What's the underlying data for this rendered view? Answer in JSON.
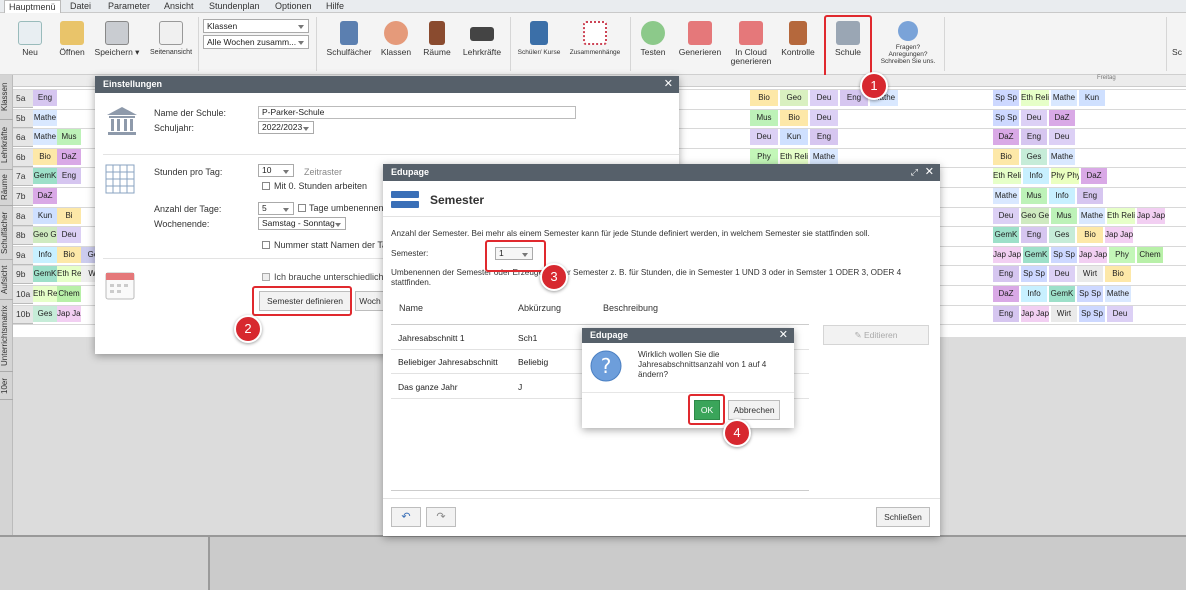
{
  "menu": {
    "items": [
      "Hauptmenü",
      "Datei",
      "Parameter",
      "Ansicht",
      "Stundenplan",
      "Optionen",
      "Hilfe"
    ]
  },
  "ribbon": {
    "new": "Neu",
    "open": "Öffnen",
    "save": "Speichern",
    "preview": "Seitenansicht",
    "combo1": "Klassen",
    "combo2": "Alle Wochen zusamm...",
    "subjects": "Schulfächer",
    "classes": "Klassen",
    "rooms": "Räume",
    "teachers": "Lehrkräfte",
    "students": "Schüler/ Kurse",
    "links": "Zusammenhänge",
    "test": "Testen",
    "generate": "Generieren",
    "cloud1": "In Cloud",
    "cloud2": "generieren",
    "check": "Kontrolle",
    "school": "Schule",
    "help1": "Fragen?",
    "help2": "Anregungen?",
    "help3": "Schreiben Sie uns.",
    "right_cut": "Sc"
  },
  "side_tabs": [
    "Klassen",
    "Lehrkräfte",
    "Räume",
    "Schulfächer",
    "Aufsicht",
    "Unterrichtsmatrix",
    "10er"
  ],
  "grid": {
    "classes": [
      "5a",
      "5b",
      "6a",
      "6b",
      "7a",
      "7b",
      "8a",
      "8b",
      "9a",
      "9b",
      "10a",
      "10b"
    ],
    "day_label": "Freitag",
    "mid_cells": [
      [
        "Bio",
        "Geo",
        "Deu",
        "Eng",
        "Mathe"
      ],
      [
        "Mus",
        "Bio",
        "Deu"
      ],
      [
        "Deu",
        "Kun",
        "Eng"
      ],
      [
        "Phy",
        "Eth Reli",
        "Mathe"
      ]
    ],
    "right_cells": [
      [
        "Sp Sp",
        "Eth Reli",
        "Mathe",
        "Kun"
      ],
      [
        "Sp Sp",
        "Deu",
        "DaZ"
      ],
      [
        "DaZ",
        "Eng",
        "Deu"
      ],
      [
        "Bio",
        "Ges",
        "Mathe"
      ],
      [
        "Eth Reli",
        "Info",
        "Phy Phy",
        "DaZ"
      ],
      [
        "Mathe",
        "Mus",
        "Info",
        "Eng"
      ],
      [
        "Deu",
        "Geo Geo",
        "Mus",
        "Mathe",
        "Eth Reli",
        "Jap Jap"
      ],
      [
        "GemK",
        "Eng",
        "Ges",
        "Bio",
        "Jap Jap"
      ],
      [
        "Jap Jap",
        "GemK",
        "Sp Sp",
        "Jap Jap",
        "Phy",
        "Chem"
      ],
      [
        "Eng",
        "Sp Sp",
        "Deu",
        "Wirt",
        "Bio"
      ],
      [
        "DaZ",
        "Info",
        "GemK",
        "Sp Sp",
        "Mathe"
      ],
      [
        "Eng",
        "Jap Jap",
        "Wirt",
        "Sp Sp",
        "Deu"
      ]
    ],
    "left_cells": [
      [
        "Eng"
      ],
      [
        "Mathe"
      ],
      [
        "Mathe",
        "Mus"
      ],
      [
        "Bio",
        "DaZ"
      ],
      [
        "GemK",
        "Eng"
      ],
      [
        "DaZ"
      ],
      [
        "Kun",
        "Bi"
      ],
      [
        "Geo Geo",
        "Deu"
      ],
      [
        "Info",
        "Bio",
        "Ge"
      ],
      [
        "GemK",
        "Eth Reli",
        "Wi"
      ],
      [
        "Eth Reli",
        "Chem"
      ],
      [
        "Ges",
        "Jap Jap"
      ]
    ]
  },
  "settings": {
    "title": "Einstellungen",
    "school_name_label": "Name der Schule:",
    "school_name": "P-Parker-Schule",
    "school_year_label": "Schuljahr:",
    "school_year": "2022/2023",
    "hours_label": "Stunden pro Tag:",
    "hours": "10",
    "zeitraster": "Zeitraster",
    "zero_hours": "Mit 0. Stunden arbeiten",
    "days_label": "Anzahl der Tage:",
    "days": "5",
    "rename_days": "Tage umbenennen",
    "weekend_label": "Wochenende:",
    "weekend": "Samstag - Sonntag",
    "number_names": "Nummer statt Namen der Tag",
    "need_diff": "Ich brauche unterschiedliche",
    "semester_btn": "Semester definieren",
    "week_btn": "Woch"
  },
  "semester": {
    "title": "Edupage",
    "heading": "Semester",
    "desc": "Anzahl der Semester. Bei mehr als einem Semester kann für jede Stunde definiert werden, in welchem Semester sie stattfinden soll.",
    "count_label": "Semester:",
    "count": "1",
    "rename_desc": "Umbenennen der Semester oder Erzeugen neuer Semester z. B. für Stunden, die in Semester 1 UND 3 oder in Semster 1 ODER 3, ODER 4 stattfinden.",
    "col_name": "Name",
    "col_abbr": "Abkürzung",
    "col_desc": "Beschreibung",
    "rows": [
      {
        "name": "Jahresabschnitt 1",
        "abbr": "Sch1"
      },
      {
        "name": "Beliebiger Jahresabschnitt",
        "abbr": "Beliebig"
      },
      {
        "name": "Das ganze Jahr",
        "abbr": "J"
      }
    ],
    "edit_btn": "Editieren",
    "close_btn": "Schließen"
  },
  "confirm": {
    "title": "Edupage",
    "message": "Wirklich wollen Sie die Jahresabschnittsanzahl von 1 auf 4 ändern?",
    "ok": "OK",
    "cancel": "Abbrechen"
  },
  "markers": [
    "1",
    "2",
    "3",
    "4"
  ],
  "colors": {
    "accent": "#d7282f",
    "dialog_title": "#56606a",
    "ok_green": "#3aa55a",
    "semester_icon": "#3a6fb7"
  }
}
